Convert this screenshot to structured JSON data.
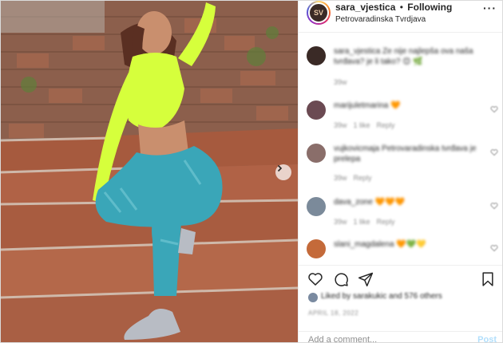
{
  "post": {
    "username": "sara_vjestica",
    "separator": "•",
    "follow_status": "Following",
    "location": "Petrovaradinska Tvrdjava",
    "avatar_initials": "SV",
    "more_icon": "more-dots-icon"
  },
  "caption": {
    "text": "sara_vjestica Ze nije najlepša ova naša tvrđava? je li tako?",
    "emoji": "😊 🌿",
    "time": "39w"
  },
  "comments": [
    {
      "user": "marijuletmarina",
      "text": "🧡",
      "time": "39w",
      "likes": "1 like",
      "reply": "Reply",
      "avatar_color": "#6b4a52"
    },
    {
      "user": "vujkovicmaja",
      "text": "Petrovaradinska tvrđava je prelepa",
      "time": "39w",
      "likes": "",
      "reply": "Reply",
      "avatar_color": "#8a6e6a"
    },
    {
      "user": "dava_zone",
      "text": "🧡🧡🧡",
      "time": "39w",
      "likes": "1 like",
      "reply": "Reply",
      "avatar_color": "#7b8a9a"
    },
    {
      "user": "slani_magdalena",
      "text": "🧡💚💛",
      "time": "",
      "likes": "",
      "reply": "",
      "avatar_color": "#c46a3a"
    }
  ],
  "actions": {
    "like_icon": "heart-icon",
    "comment_icon": "comment-bubble-icon",
    "share_icon": "paper-plane-icon",
    "save_icon": "bookmark-icon",
    "liked_by": "Liked by sarakukic and 576 others",
    "date": "APRIL 18, 2022"
  },
  "comment_box": {
    "placeholder": "Add a comment...",
    "post_label": "Post"
  },
  "photo": {
    "next_icon": "chevron-right-icon",
    "top_color": "#d7ff3a",
    "leggings_color": "#3aa6b8"
  }
}
